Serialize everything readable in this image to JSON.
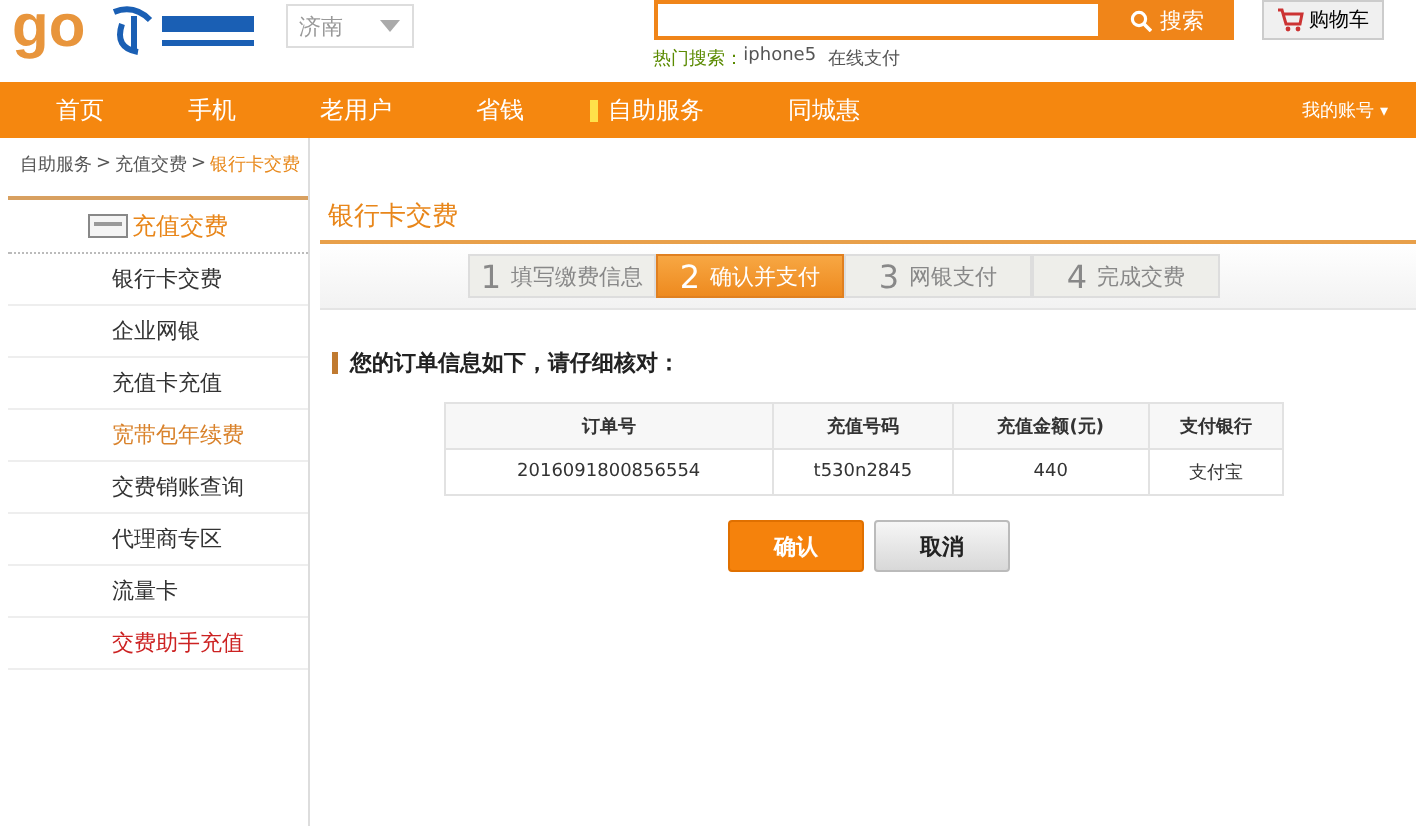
{
  "header": {
    "logo": "go",
    "city_select": {
      "value": "济南"
    },
    "search_button": "搜索",
    "cart_button": "购物车",
    "hot_search": {
      "label": "热门搜索：",
      "links": [
        "iphone5",
        "在线支付"
      ]
    }
  },
  "nav": {
    "items": [
      {
        "label": "首页",
        "selected": false
      },
      {
        "label": "手机",
        "selected": false
      },
      {
        "label": "老用户",
        "selected": false
      },
      {
        "label": "省钱",
        "selected": false
      },
      {
        "label": "自助服务",
        "selected": true
      },
      {
        "label": "同城惠",
        "selected": false
      }
    ],
    "account": "我的账号",
    "account_caret": "▾"
  },
  "breadcrumb": [
    {
      "label": "自助服务",
      "current": false,
      "separator": ">"
    },
    {
      "label": "充值交费",
      "current": false,
      "separator": ">"
    },
    {
      "label": "银行卡交费",
      "current": true
    }
  ],
  "sidebar": {
    "title": "充值交费",
    "items": [
      {
        "label": "银行卡交费",
        "color": "#333333"
      },
      {
        "label": "企业网银",
        "color": "#333333"
      },
      {
        "label": "充值卡充值",
        "color": "#333333"
      },
      {
        "label": "宽带包年续费",
        "color": "#d9822b"
      },
      {
        "label": "交费销账查询",
        "color": "#333333"
      },
      {
        "label": "代理商专区",
        "color": "#333333"
      },
      {
        "label": "流量卡",
        "color": "#333333"
      },
      {
        "label": "交费助手充值",
        "color": "#cc2222"
      }
    ]
  },
  "main": {
    "title": "银行卡交费",
    "steps": [
      {
        "number": "1",
        "label": "填写缴费信息",
        "selected": false
      },
      {
        "number": "2",
        "label": "确认并支付",
        "selected": true
      },
      {
        "number": "3",
        "label": "网银支付",
        "selected": false
      },
      {
        "number": "4",
        "label": "完成交费",
        "selected": false
      }
    ],
    "notice": "您的订单信息如下，请仔细核对：",
    "table": {
      "columns": [
        "订单号",
        "充值号码",
        "充值金额(元)",
        "支付银行"
      ],
      "rows": [
        [
          "2016091800856554",
          "t530n2845",
          "440",
          "支付宝"
        ]
      ]
    },
    "buttons": [
      {
        "label": "确认",
        "kind": "primary"
      },
      {
        "label": "取消",
        "kind": "secondary"
      }
    ]
  }
}
